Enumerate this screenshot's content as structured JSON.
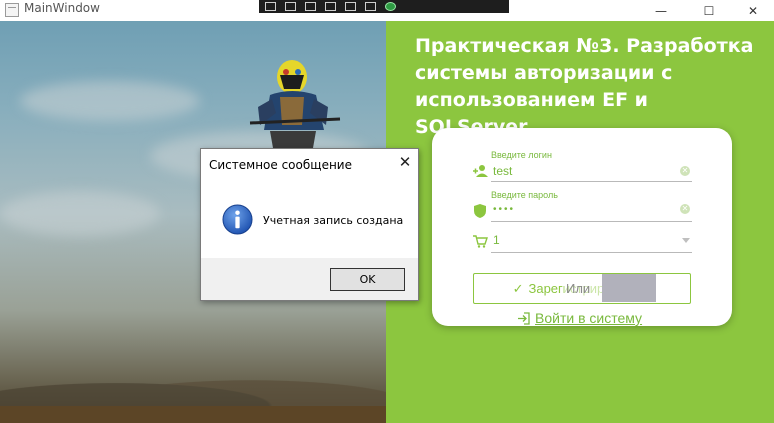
{
  "window": {
    "title": "MainWindow",
    "controls": {
      "minimize": "—",
      "maximize": "☐",
      "close": "✕"
    }
  },
  "headline": "Практическая  №3. Разработка системы авторизации с использованием EF и SQLServer",
  "form": {
    "login": {
      "label": "Введите логин",
      "value": "test",
      "icon": "add-user-icon"
    },
    "password": {
      "label": "Введите пароль",
      "value": "••••",
      "icon": "shield-icon"
    },
    "role": {
      "value": "1",
      "icon": "cart-icon"
    },
    "register_label": "Зарегистрироваться",
    "or_label": "Или",
    "login_link_label": "Войти в систему"
  },
  "messagebox": {
    "title": "Системное сообщение",
    "message": "Учетная запись создана",
    "ok_label": "OK",
    "icon": "info-icon"
  },
  "colors": {
    "accent_green": "#8cc63f",
    "text_green": "#79b93d",
    "headline_white": "#ffffff"
  }
}
